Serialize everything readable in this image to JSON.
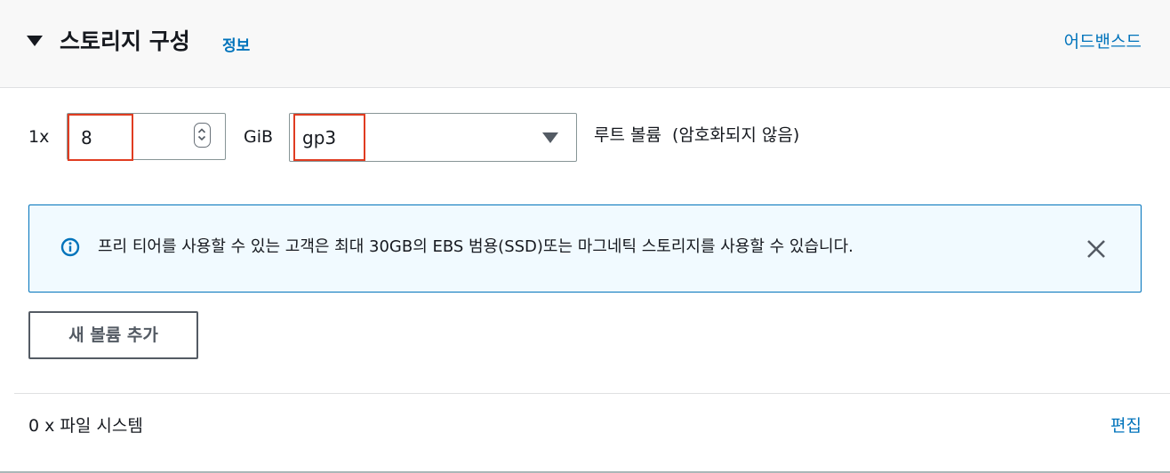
{
  "header": {
    "title": "스토리지 구성",
    "info_link": "정보",
    "advanced_link": "어드밴스드"
  },
  "volume": {
    "count_prefix": "1x",
    "size_value": "8",
    "size_unit": "GiB",
    "type_value": "gp3",
    "description": "루트 볼륨  (암호화되지 않음)"
  },
  "alert": {
    "type": "info",
    "message": "프리 티어를 사용할 수 있는 고객은 최대 30GB의 EBS 범용(SSD)또는 마그네틱 스토리지를 사용할 수 있습니다."
  },
  "add_volume_button": "새 볼륨 추가",
  "file_systems": {
    "summary": "0 x 파일 시스템",
    "edit_link": "편집"
  },
  "colors": {
    "link": "#0073bb",
    "highlight": "#e03c21",
    "alert_bg": "#f1faff",
    "alert_border": "#0073bb"
  },
  "icons": [
    "collapse-caret-icon",
    "stepper-icon",
    "dropdown-caret-icon",
    "info-icon",
    "close-icon"
  ]
}
